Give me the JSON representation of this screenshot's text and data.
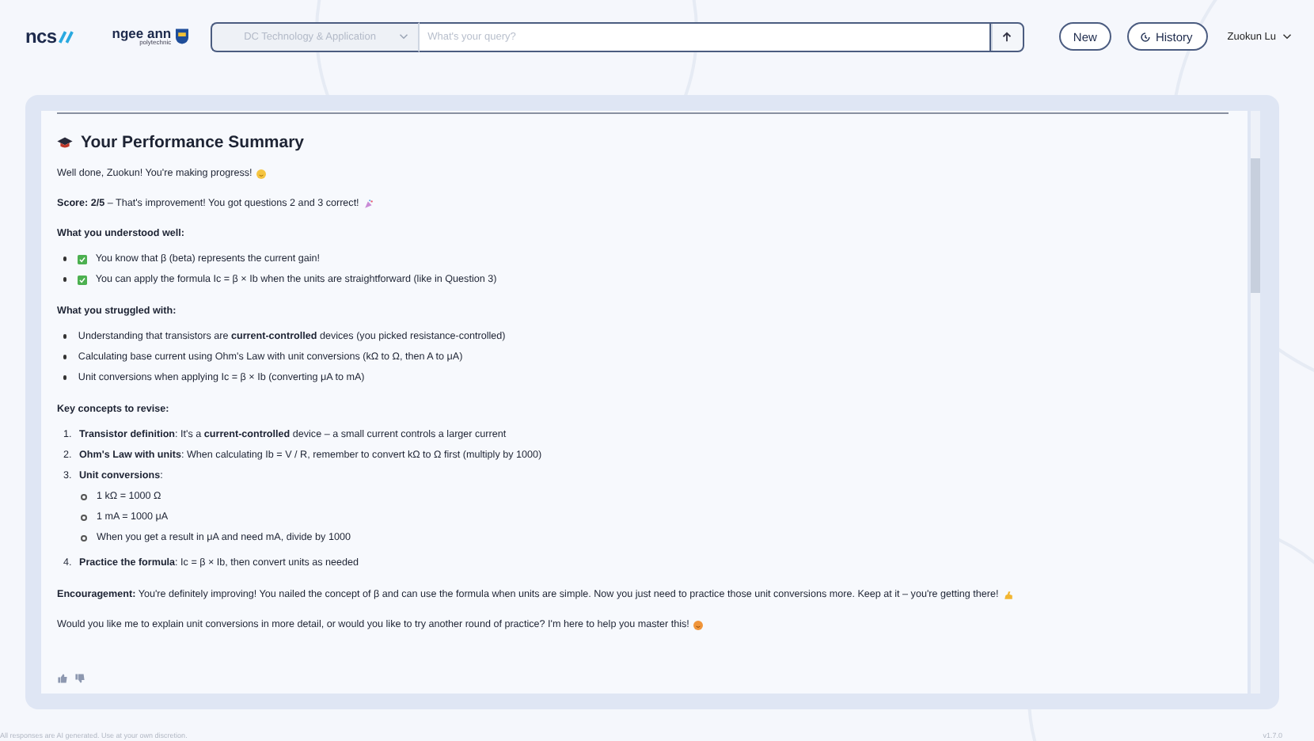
{
  "header": {
    "brand": "ncs",
    "school": {
      "name": "ngee ann",
      "sub": "polytechnic"
    },
    "module_select": {
      "value": "DC Technology & Application",
      "disabled": true
    },
    "query": {
      "placeholder": "What's your query?"
    },
    "buttons": [
      {
        "kind": "new",
        "label": "New"
      },
      {
        "kind": "history",
        "label": "History"
      }
    ],
    "user": {
      "name": "Zuokun Lu"
    }
  },
  "message": {
    "title": "Your Performance Summary",
    "blocks": [
      {
        "kind": "paragraph",
        "text": "Well done, Zuokun! You're making progress!",
        "icon": {
          "kind": "smile"
        }
      },
      {
        "kind": "paragraph",
        "text": "**Score: 2/5** – That's improvement! You got questions 2 and 3 correct!",
        "icon": {
          "kind": "party"
        }
      },
      {
        "kind": "heading",
        "text": "What you understood well:"
      },
      {
        "kind": "list",
        "items": [
          {
            "kind": "check",
            "text": "You know that β (beta) represents the current gain!"
          },
          {
            "kind": "check",
            "text": "You can apply the formula Ic = β × Ib when the units are straightforward (like in Question 3)"
          }
        ]
      },
      {
        "kind": "heading",
        "text": "What you struggled with:"
      },
      {
        "kind": "list",
        "items": [
          {
            "kind": "bullet",
            "text": "Understanding that transistors are **current-controlled** devices (you picked resistance-controlled)"
          },
          {
            "kind": "bullet",
            "text": "Calculating base current using Ohm's Law with unit conversions (kΩ to Ω, then A to μA)"
          },
          {
            "kind": "bullet",
            "text": "Unit conversions when applying Ic = β × Ib (converting μA to mA)"
          }
        ]
      },
      {
        "kind": "heading",
        "text": "Key concepts to revise:"
      },
      {
        "kind": "numbered",
        "items": [
          {
            "number": "1.",
            "text": "**Transistor definition**: It's a **current-controlled** device – a small current controls a larger current"
          },
          {
            "number": "2.",
            "text": "**Ohm's Law with units**: When calculating Ib = V / R, remember to convert kΩ to Ω first (multiply by 1000)"
          },
          {
            "number": "3.",
            "text": "**Unit conversions**:",
            "children": [
              {
                "text": "1 kΩ = 1000 Ω"
              },
              {
                "text": "1 mA = 1000 μA"
              },
              {
                "text": "When you get a result in μA and need mA, divide by 1000"
              }
            ]
          },
          {
            "number": "4.",
            "text": "**Practice the formula**: Ic = β × Ib, then convert units as needed"
          }
        ]
      },
      {
        "kind": "paragraph",
        "text": "**Encouragement:** You're definitely improving! You nailed the concept of β and can use the formula when units are simple. Now you just need to practice those unit conversions more. Keep at it – you're getting there!",
        "icon": {
          "kind": "arm"
        }
      },
      {
        "kind": "paragraph",
        "text": "Would you like me to explain unit conversions in more detail, or would you like to try another round of practice? I'm here to help you master this!",
        "icon": {
          "kind": "face"
        }
      }
    ]
  },
  "footer": {
    "disclaimer": "All responses are AI generated. Use at your own discretion.",
    "version": "v1.7.0"
  }
}
